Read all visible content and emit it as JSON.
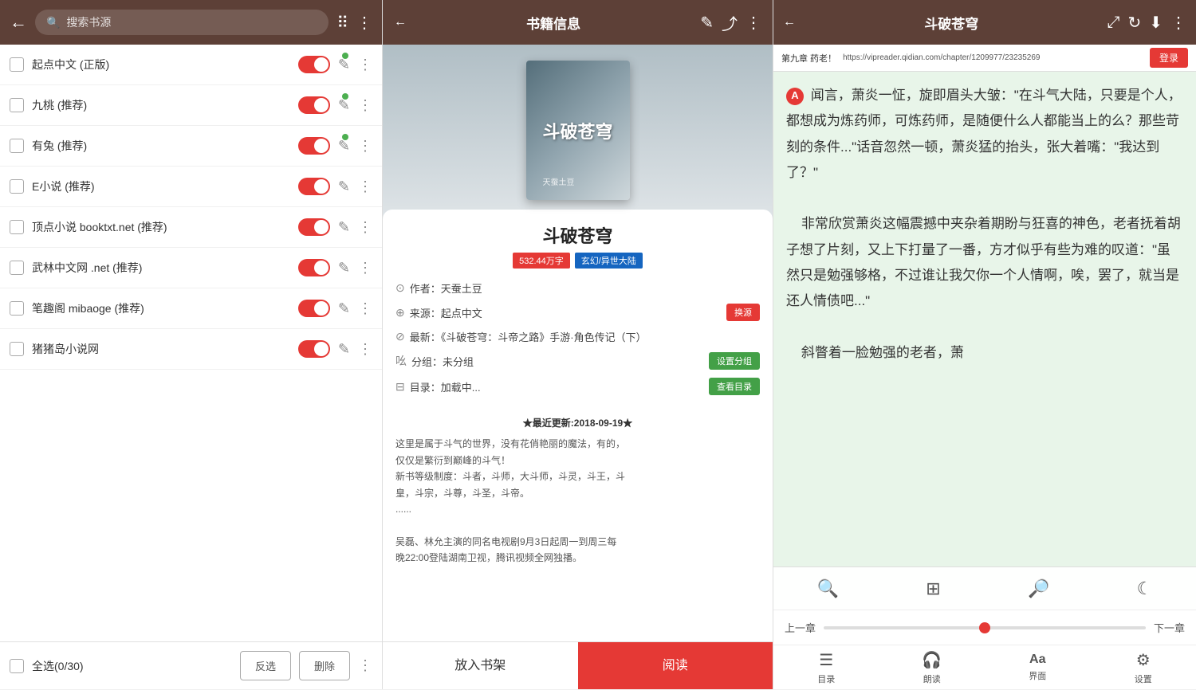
{
  "sources_panel": {
    "header": {
      "back_icon": "←",
      "search_placeholder": "搜索书源",
      "qr_icon": "⠿",
      "more_icon": "⋮"
    },
    "items": [
      {
        "name": "起点中文 (正版)",
        "has_dot": true
      },
      {
        "name": "九桃 (推荐)",
        "has_dot": true
      },
      {
        "name": "有兔 (推荐)",
        "has_dot": true
      },
      {
        "name": "E小说 (推荐)",
        "has_dot": false
      },
      {
        "name": "顶点小说 booktxt.net (推荐)",
        "has_dot": false
      },
      {
        "name": "武林中文网 .net (推荐)",
        "has_dot": false
      },
      {
        "name": "笔趣阁 mibaoge (推荐)",
        "has_dot": false
      },
      {
        "name": "猪猪岛小说网",
        "has_dot": false
      }
    ],
    "footer": {
      "select_all_label": "全选(0/30)",
      "invert_label": "反选",
      "delete_label": "删除",
      "more_icon": "⋮"
    }
  },
  "info_panel": {
    "header": {
      "back_icon": "←",
      "title": "书籍信息",
      "edit_icon": "✎",
      "share_icon": "⤴",
      "more_icon": "⋮"
    },
    "book": {
      "title": "斗破苍穹",
      "word_count": "532.44万字",
      "tag1": "玄幻/异世大陆",
      "author_label": "作者：天蚕土豆",
      "source_label": "来源：起点中文",
      "switch_source_btn": "换源",
      "latest_label": "最新：《斗破苍穹：斗帝之路》手游·角色传记（下）",
      "group_label": "吆 分组：未分组",
      "set_group_btn": "设置分组",
      "catalog_label": "目录：加载中...",
      "view_catalog_btn": "查看目录",
      "desc_update": "★最近更新:2018-09-19★",
      "desc_line1": "这里是属于斗气的世界，没有花俏艳丽的魔法，有的，",
      "desc_line2": "仅仅是繁衍到巅峰的斗气！",
      "desc_line3": "新书等级制度：斗者，斗师，大斗师，斗灵，斗王，斗",
      "desc_line4": "皇，斗宗，斗尊，斗圣，斗帝。",
      "desc_line5": "......",
      "desc_line6": "吴磊、林允主演的同名电视剧9月3日起周一到周三每",
      "desc_line7": "晚22:00登陆湖南卫视，腾讯视频全网独播。"
    },
    "footer": {
      "shelf_label": "放入书架",
      "read_label": "阅读"
    }
  },
  "reader_panel": {
    "header": {
      "back_icon": "←",
      "title": "斗破苍穹",
      "fullscreen_icon": "⤢",
      "refresh_icon": "↻",
      "download_icon": "⬇",
      "more_icon": "⋮"
    },
    "url_bar": {
      "chapter": "第九章 药老！",
      "url": "https://vipreader.qidian.com/chapter/1209977/23235269",
      "login_btn": "登录"
    },
    "content": {
      "paragraph1": "闻言，萧炎一怔，旋即眉头大皱：\"在斗气大陆，只要是个人，都想成为炼药师，可炼药师，是随便什么人都能当上的么？那些苛刻的条件...\"话音忽然一顿，萧炎猛的抬头，张大着嘴：\"我达到了？\"",
      "paragraph2": "非常欣赏萧炎这幅震撼中夹杂着期盼与狂喜的神色，老者抚着胡子想了片刻，又上下打量了一番，方才似乎有些为难的叹道：\"虽然只是勉强够格，不过谁让我欠你一个人情啊，唉，罢了，就当是还人情债吧...\"",
      "paragraph3": "斜瞥着一脸勉强的老者，萧"
    },
    "toolbar": {
      "search_icon": "🔍",
      "layout_icon": "⊞",
      "zoom_icon": "🔎",
      "night_icon": "☾"
    },
    "progress": {
      "prev_label": "上一章",
      "next_label": "下一章"
    },
    "nav": [
      {
        "icon": "☰",
        "label": "目录"
      },
      {
        "icon": "🎧",
        "label": "朗读"
      },
      {
        "icon": "Aa",
        "label": "界面"
      },
      {
        "icon": "⚙",
        "label": "设置"
      }
    ]
  }
}
